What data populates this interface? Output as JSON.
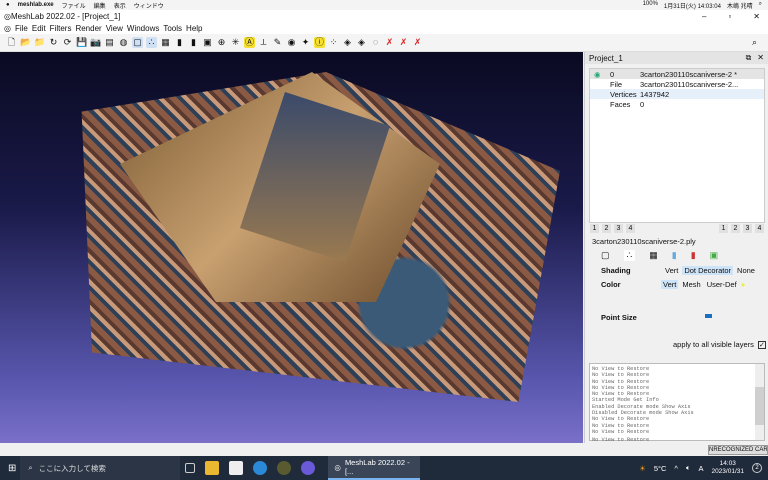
{
  "macbar": {
    "app": "meshlab.exe",
    "menus": [
      "ファイル",
      "編集",
      "表示",
      "ウィンドウ"
    ],
    "battery": "100%",
    "datetime": "1月31日(火) 14:03:04",
    "user": "木嶋 兆晴"
  },
  "window": {
    "title": "MeshLab 2022.02 - [Project_1]",
    "minimize": "–",
    "restore": "▫",
    "close": "✕"
  },
  "menu": [
    "File",
    "Edit",
    "Filters",
    "Render",
    "View",
    "Windows",
    "Tools",
    "Help"
  ],
  "toolbar": {
    "icons": [
      "new-file",
      "open",
      "open-project",
      "reload",
      "reload-all",
      "save",
      "snapshot",
      "layer",
      "sphere",
      "bbox",
      "points",
      "wireframe",
      "flat",
      "smooth",
      "texture",
      "globe",
      "align",
      "annotation",
      "measure",
      "paint",
      "pick",
      "manip",
      "info",
      "select-vert",
      "select-face",
      "select-conn",
      "select-lasso",
      "delete-vert",
      "delete-face",
      "delete-all",
      "zoom"
    ]
  },
  "panel": {
    "title": "Project_1",
    "layer": {
      "id": "0",
      "name": "3carton230110scaniverse-2 *"
    },
    "info": [
      {
        "key": "File",
        "value": "3carton230110scaniverse-2..."
      },
      {
        "key": "Vertices",
        "value": "1437942"
      },
      {
        "key": "Faces",
        "value": "0"
      }
    ],
    "view_buttons_left": [
      "1",
      "2",
      "3",
      "4"
    ],
    "view_buttons_right": [
      "1",
      "2",
      "3",
      "4"
    ],
    "filename": "3carton230110scaniverse-2.ply",
    "shading": {
      "label": "Shading",
      "options": [
        "Vert",
        "Dot Decorator",
        "None"
      ],
      "selected": "Dot Decorator"
    },
    "color": {
      "label": "Color",
      "options": [
        "Vert",
        "Mesh",
        "User-Def"
      ],
      "selected": "Vert"
    },
    "point_size": {
      "label": "Point Size"
    },
    "apply_all": {
      "label": "apply to all visible layers",
      "checked": true
    }
  },
  "log": [
    "No View to Restore",
    "No View to Restore",
    "No View to Restore",
    "No View to Restore",
    "No View to Restore",
    "Started Mode Get Info",
    "Enabled Decorate mode Show Axis",
    "Disabled Decorate mode Show Axis",
    "No View to Restore",
    "No View to Restore",
    "No View to Restore",
    "No View to Restore"
  ],
  "status": {
    "badge": "NRECOGNIZED CAR"
  },
  "taskbar": {
    "search_placeholder": "ここに入力して検索",
    "app_button": "MeshLab 2022.02 - [...",
    "weather": "5°C",
    "ime": "A",
    "time": "14:03",
    "date": "2023/01/31",
    "notifications": "2"
  }
}
